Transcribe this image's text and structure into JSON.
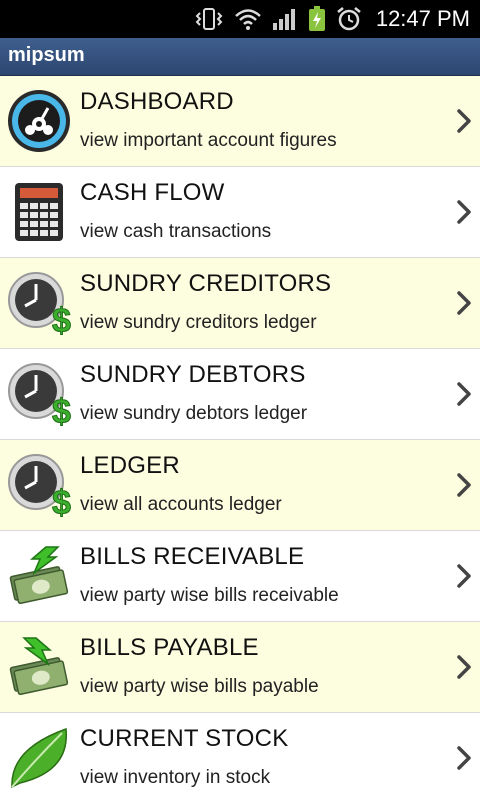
{
  "status_bar": {
    "time": "12:47 PM",
    "icons": [
      "vibrate-icon",
      "wifi-icon",
      "signal-icon",
      "battery-charging-icon",
      "alarm-icon"
    ]
  },
  "app": {
    "title": "mipsum"
  },
  "menu": {
    "items": [
      {
        "title": "DASHBOARD",
        "subtitle": " view important account figures",
        "icon": "dashboard-gauge-icon"
      },
      {
        "title": "CASH FLOW",
        "subtitle": "view cash transactions",
        "icon": "calculator-icon"
      },
      {
        "title": "SUNDRY CREDITORS",
        "subtitle": "view sundry creditors ledger",
        "icon": "clock-dollar-icon"
      },
      {
        "title": "SUNDRY DEBTORS",
        "subtitle": "view sundry debtors ledger",
        "icon": "clock-dollar-icon"
      },
      {
        "title": "LEDGER",
        "subtitle": "view all accounts ledger",
        "icon": "clock-dollar-icon"
      },
      {
        "title": "BILLS RECEIVABLE",
        "subtitle": "view party wise bills receivable",
        "icon": "money-arrow-in-icon"
      },
      {
        "title": "BILLS PAYABLE",
        "subtitle": "view party wise bills payable",
        "icon": "money-arrow-out-icon"
      },
      {
        "title": "CURRENT STOCK",
        "subtitle": "view inventory in stock",
        "icon": "leaf-icon"
      }
    ]
  },
  "colors": {
    "row_alt": "#fdfde0",
    "row_plain": "#ffffff",
    "title_bar": "#34527f",
    "dollar_green": "#3cae2e"
  }
}
